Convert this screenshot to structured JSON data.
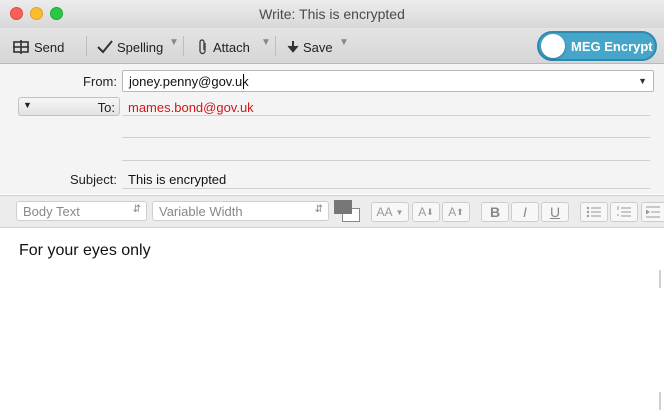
{
  "window": {
    "title": "Write: This is encrypted"
  },
  "toolbar": {
    "send_label": "Send",
    "spelling_label": "Spelling",
    "attach_label": "Attach",
    "save_label": "Save",
    "encrypt_label": "MEG Encrypt"
  },
  "headers": {
    "from_label": "From:",
    "from_value": "joney.penny@gov.uk",
    "to_label": "To:",
    "to_value": "mames.bond@gov.uk",
    "subject_label": "Subject:",
    "subject_value": "This is encrypted"
  },
  "format": {
    "paragraph_style": "Body Text",
    "font": "Variable Width",
    "font_size_down": "AA",
    "smaller_label": "A",
    "larger_label": "A",
    "bold": "B",
    "italic": "I",
    "underline": "U"
  },
  "body": {
    "text": "For your eyes only"
  },
  "colors": {
    "accent": "#46a6c9",
    "recipient": "#d01818"
  }
}
